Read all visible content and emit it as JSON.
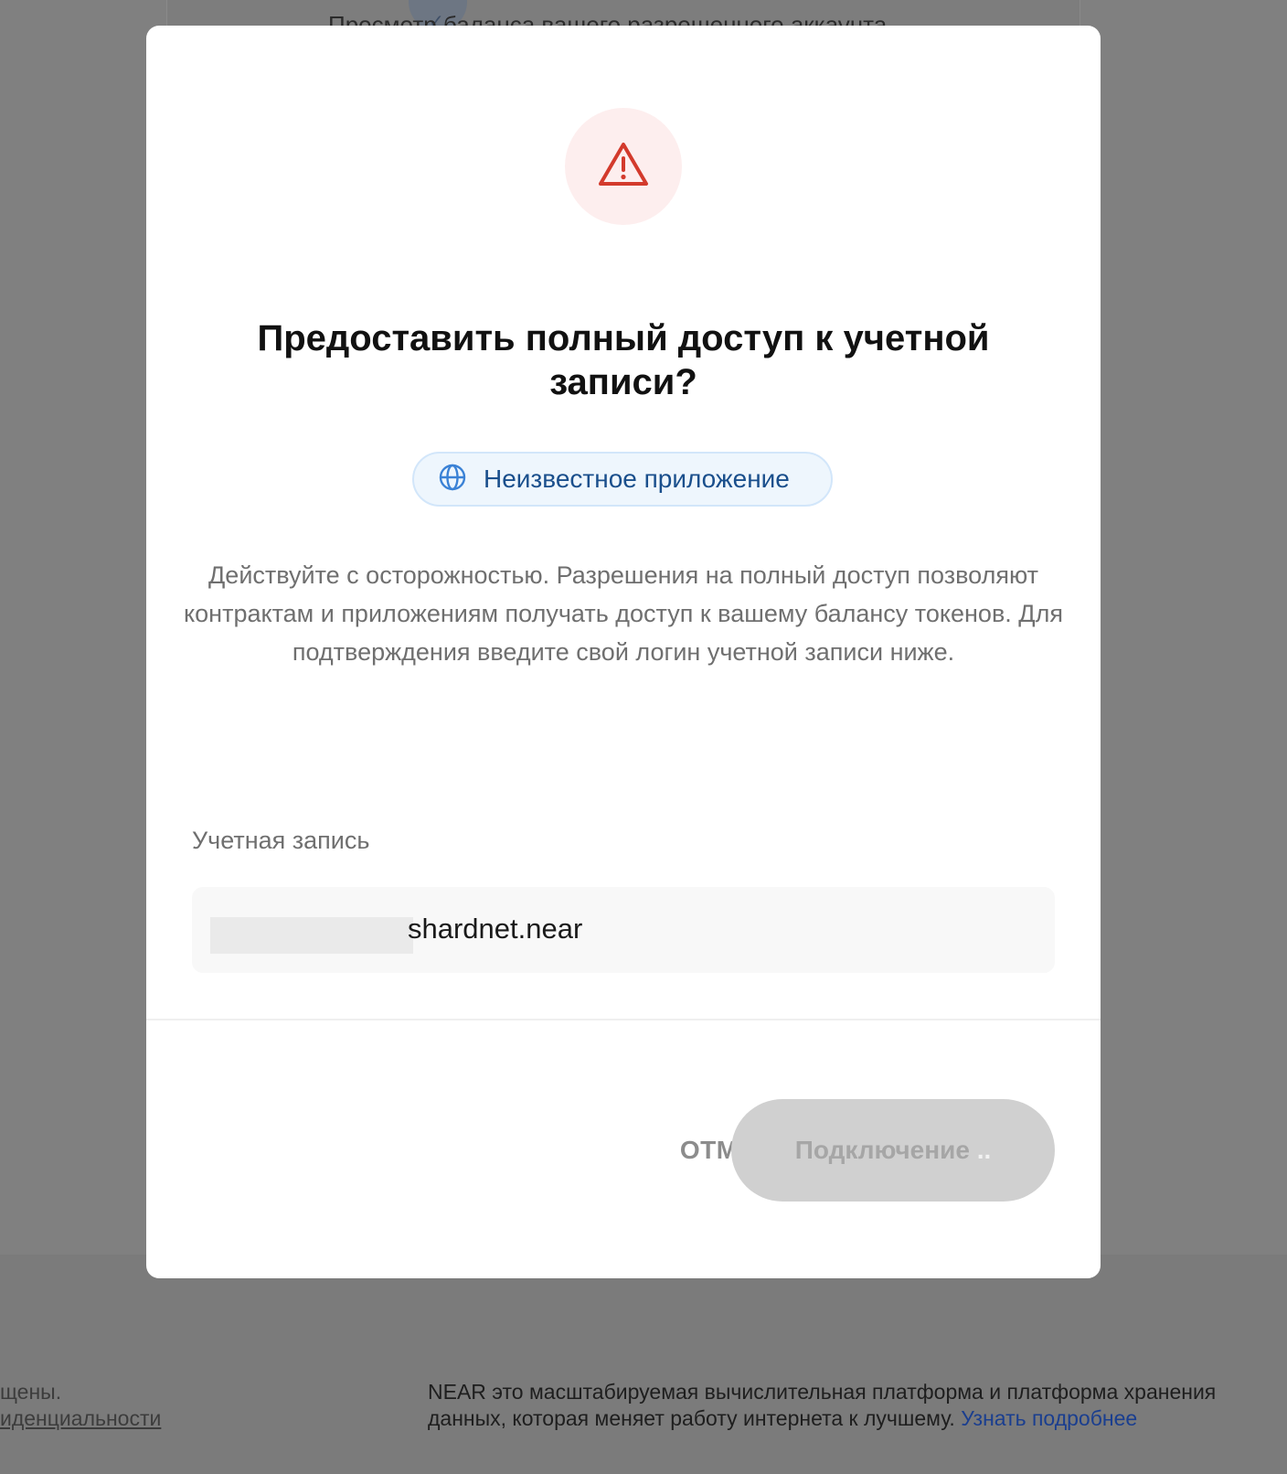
{
  "background": {
    "top_text": "Просмотр баланса вашего разрешенного аккаунта",
    "footer_left_line1": "щены.",
    "footer_left_link": "иденциальности",
    "footer_right_text": "NEAR это масштабируемая вычислительная платформа и платформа хранения данных, которая меняет работу интернета к лучшему.",
    "footer_right_link": "Узнать подробнее"
  },
  "modal": {
    "icon": "warning-icon",
    "title": "Предоставить полный доступ к учетной записи?",
    "app_icon": "globe-icon",
    "app_name": "Неизвестное приложение",
    "description": "Действуйте с осторожностью. Разрешения на полный доступ позволяют контрактам и приложениям получать доступ к вашему балансу токенов. Для подтверждения введите свой логин учетной записи ниже.",
    "account_label": "Учетная запись",
    "account_value": "shardnet.near",
    "cancel_label": "ОТМЕНА",
    "connect_label": "Подключение",
    "connect_dots": ".."
  },
  "colors": {
    "warning": "#d33a2c",
    "link": "#1a3e8f",
    "pill_text": "#1a4f8c"
  }
}
